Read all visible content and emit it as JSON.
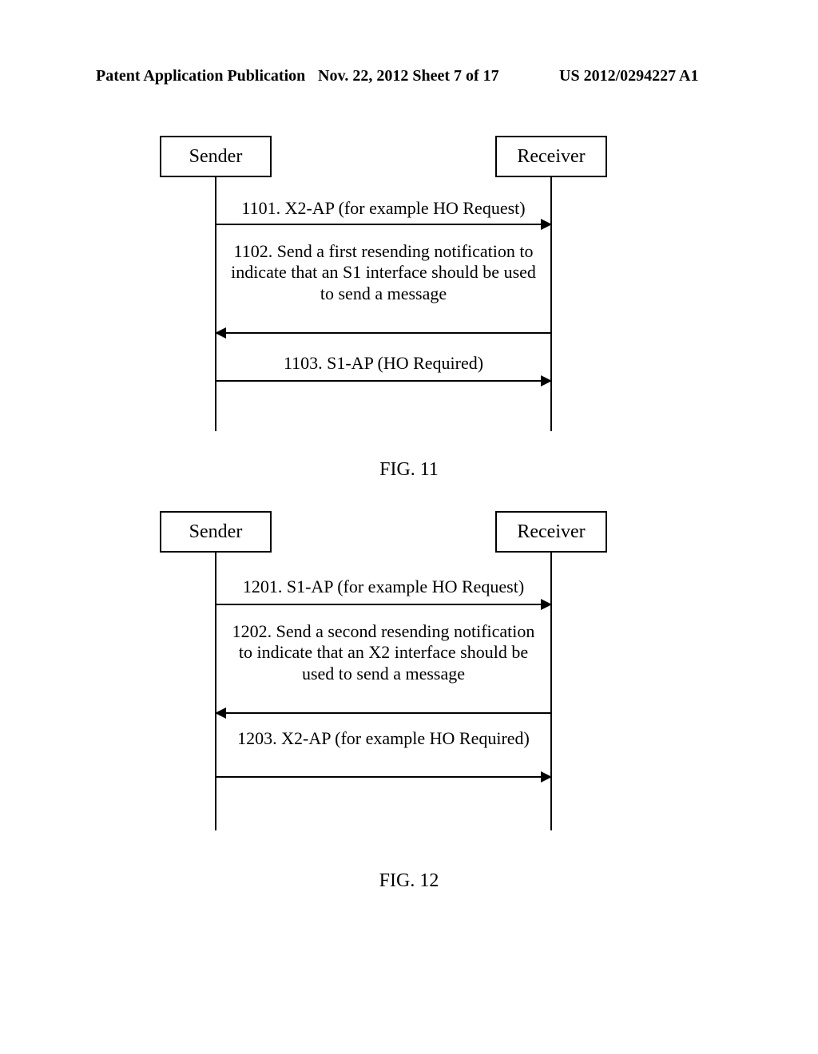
{
  "header": {
    "publication": "Patent Application Publication",
    "date_sheet": "Nov. 22, 2012  Sheet 7 of 17",
    "pub_number": "US 2012/0294227 A1"
  },
  "fig11": {
    "sender": "Sender",
    "receiver": "Receiver",
    "msg1": "1101. X2-AP (for example HO Request)",
    "msg2": "1102. Send a first resending notification to indicate that an S1 interface should be used to send a message",
    "msg3": "1103. S1-AP (HO Required)",
    "caption": "FIG. 11"
  },
  "fig12": {
    "sender": "Sender",
    "receiver": "Receiver",
    "msg1": "1201. S1-AP (for example HO Request)",
    "msg2": "1202. Send a second resending notification to indicate that an X2 interface should be used to send a message",
    "msg3": "1203. X2-AP (for example HO Required)",
    "caption": "FIG. 12"
  }
}
